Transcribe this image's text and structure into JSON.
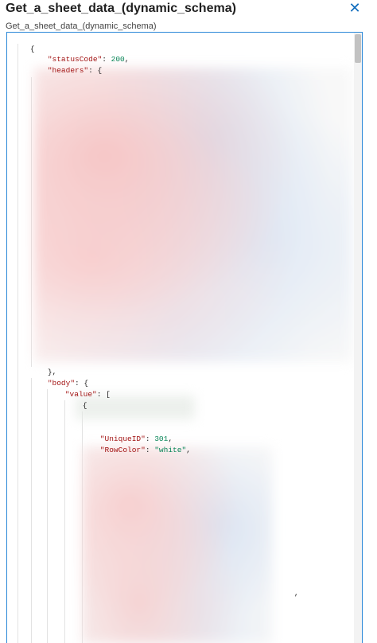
{
  "header": {
    "title": "Get_a_sheet_data_(dynamic_schema)",
    "close_icon": "close-icon"
  },
  "field": {
    "label": "Get_a_sheet_data_(dynamic_schema)"
  },
  "code": {
    "open_brace": "{",
    "status_key": "\"statusCode\"",
    "colon_space": ": ",
    "status_value": "200",
    "comma": ",",
    "headers_key": "\"headers\"",
    "headers_open": ": {",
    "headers_close": "},",
    "body_key": "\"body\"",
    "body_open": ": {",
    "value_key": "\"value\"",
    "value_open": ": [",
    "item_open": "{",
    "uniqueid_key": "\"UniqueID\"",
    "uniqueid_value": "301",
    "rowcolor_key": "\"RowColor\"",
    "rowcolor_value": "\"white\"",
    "trailing_comma": ","
  },
  "colors": {
    "accent": "#2b88d8",
    "json_key": "#a31515",
    "json_number": "#098658"
  }
}
